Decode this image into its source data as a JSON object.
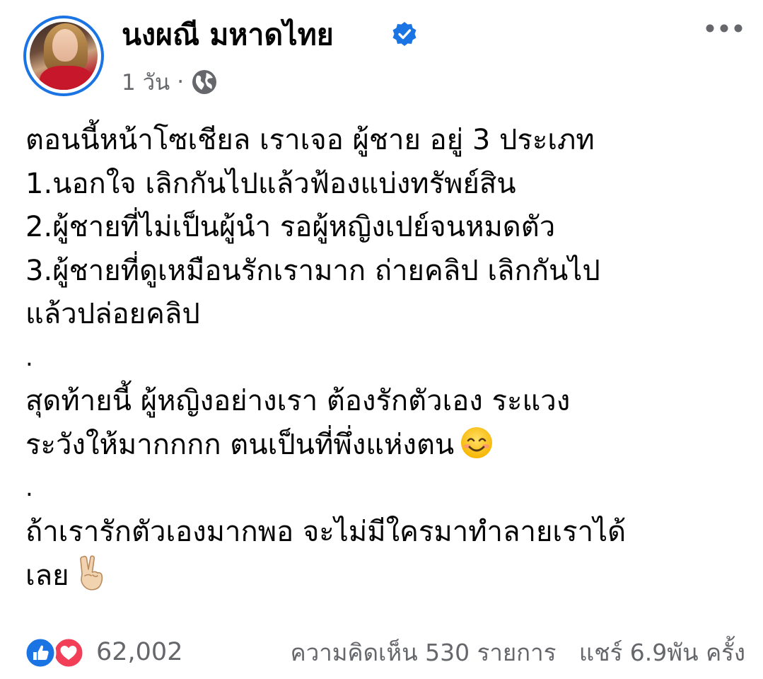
{
  "post": {
    "author_name": "นงผณี มหาดไทย",
    "timestamp": "1 วัน",
    "separator": "·",
    "privacy_icon": "globe-icon",
    "verified_icon": "verified-badge-icon",
    "more_icon": "more-options-icon",
    "lines": [
      "ตอนนี้หน้าโซเชียล เราเจอ ผู้ชาย อยู่ 3 ประเภท",
      "1.นอกใจ เลิกกันไปแล้วฟ้องแบ่งทรัพย์สิน",
      "2.ผู้ชายที่ไม่เป็นผู้นำ รอผู้หญิงเปย์จนหมดตัว",
      "3.ผู้ชายที่ดูเหมือนรักเรามาก ถ่ายคลิป เลิกกันไป",
      "แล้วปล่อยคลิป",
      ".",
      " สุดท้ายนี้ ผู้หญิงอย่างเรา ต้องรักตัวเอง ระแวง",
      "ระวังให้มากกกก ตนเป็นที่พึ่งแห่งตน",
      ".",
      " ถ้าเรารักตัวเองมากพอ จะไม่มีใครมาทำลายเราได้",
      "เลย"
    ]
  },
  "footer": {
    "reaction_count": "62,002",
    "comments": "ความคิดเห็น 530 รายการ",
    "shares": "แชร์ 6.9พัน ครั้ง"
  },
  "colors": {
    "accent": "#1b74e4",
    "love": "#f33e58",
    "muted": "#65676b"
  }
}
